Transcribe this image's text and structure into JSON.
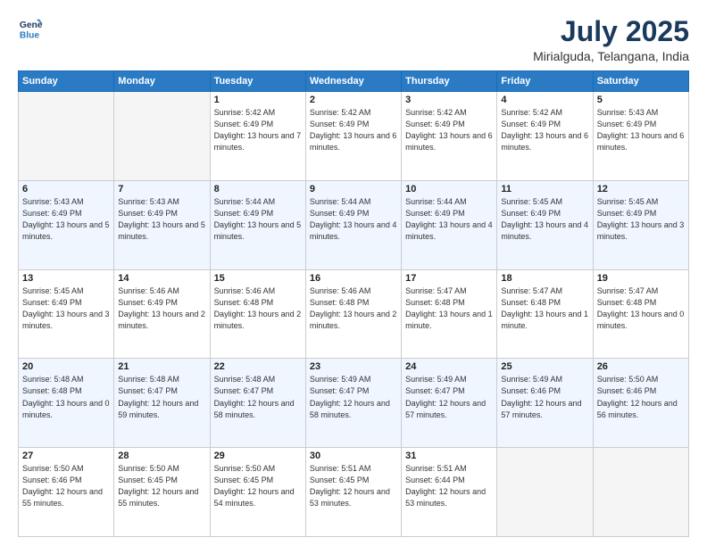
{
  "logo": {
    "line1": "General",
    "line2": "Blue"
  },
  "title": "July 2025",
  "subtitle": "Mirialguda, Telangana, India",
  "weekdays": [
    "Sunday",
    "Monday",
    "Tuesday",
    "Wednesday",
    "Thursday",
    "Friday",
    "Saturday"
  ],
  "weeks": [
    [
      {
        "day": "",
        "detail": ""
      },
      {
        "day": "",
        "detail": ""
      },
      {
        "day": "1",
        "detail": "Sunrise: 5:42 AM\nSunset: 6:49 PM\nDaylight: 13 hours\nand 7 minutes."
      },
      {
        "day": "2",
        "detail": "Sunrise: 5:42 AM\nSunset: 6:49 PM\nDaylight: 13 hours\nand 6 minutes."
      },
      {
        "day": "3",
        "detail": "Sunrise: 5:42 AM\nSunset: 6:49 PM\nDaylight: 13 hours\nand 6 minutes."
      },
      {
        "day": "4",
        "detail": "Sunrise: 5:42 AM\nSunset: 6:49 PM\nDaylight: 13 hours\nand 6 minutes."
      },
      {
        "day": "5",
        "detail": "Sunrise: 5:43 AM\nSunset: 6:49 PM\nDaylight: 13 hours\nand 6 minutes."
      }
    ],
    [
      {
        "day": "6",
        "detail": "Sunrise: 5:43 AM\nSunset: 6:49 PM\nDaylight: 13 hours\nand 5 minutes."
      },
      {
        "day": "7",
        "detail": "Sunrise: 5:43 AM\nSunset: 6:49 PM\nDaylight: 13 hours\nand 5 minutes."
      },
      {
        "day": "8",
        "detail": "Sunrise: 5:44 AM\nSunset: 6:49 PM\nDaylight: 13 hours\nand 5 minutes."
      },
      {
        "day": "9",
        "detail": "Sunrise: 5:44 AM\nSunset: 6:49 PM\nDaylight: 13 hours\nand 4 minutes."
      },
      {
        "day": "10",
        "detail": "Sunrise: 5:44 AM\nSunset: 6:49 PM\nDaylight: 13 hours\nand 4 minutes."
      },
      {
        "day": "11",
        "detail": "Sunrise: 5:45 AM\nSunset: 6:49 PM\nDaylight: 13 hours\nand 4 minutes."
      },
      {
        "day": "12",
        "detail": "Sunrise: 5:45 AM\nSunset: 6:49 PM\nDaylight: 13 hours\nand 3 minutes."
      }
    ],
    [
      {
        "day": "13",
        "detail": "Sunrise: 5:45 AM\nSunset: 6:49 PM\nDaylight: 13 hours\nand 3 minutes."
      },
      {
        "day": "14",
        "detail": "Sunrise: 5:46 AM\nSunset: 6:49 PM\nDaylight: 13 hours\nand 2 minutes."
      },
      {
        "day": "15",
        "detail": "Sunrise: 5:46 AM\nSunset: 6:48 PM\nDaylight: 13 hours\nand 2 minutes."
      },
      {
        "day": "16",
        "detail": "Sunrise: 5:46 AM\nSunset: 6:48 PM\nDaylight: 13 hours\nand 2 minutes."
      },
      {
        "day": "17",
        "detail": "Sunrise: 5:47 AM\nSunset: 6:48 PM\nDaylight: 13 hours\nand 1 minute."
      },
      {
        "day": "18",
        "detail": "Sunrise: 5:47 AM\nSunset: 6:48 PM\nDaylight: 13 hours\nand 1 minute."
      },
      {
        "day": "19",
        "detail": "Sunrise: 5:47 AM\nSunset: 6:48 PM\nDaylight: 13 hours\nand 0 minutes."
      }
    ],
    [
      {
        "day": "20",
        "detail": "Sunrise: 5:48 AM\nSunset: 6:48 PM\nDaylight: 13 hours\nand 0 minutes."
      },
      {
        "day": "21",
        "detail": "Sunrise: 5:48 AM\nSunset: 6:47 PM\nDaylight: 12 hours\nand 59 minutes."
      },
      {
        "day": "22",
        "detail": "Sunrise: 5:48 AM\nSunset: 6:47 PM\nDaylight: 12 hours\nand 58 minutes."
      },
      {
        "day": "23",
        "detail": "Sunrise: 5:49 AM\nSunset: 6:47 PM\nDaylight: 12 hours\nand 58 minutes."
      },
      {
        "day": "24",
        "detail": "Sunrise: 5:49 AM\nSunset: 6:47 PM\nDaylight: 12 hours\nand 57 minutes."
      },
      {
        "day": "25",
        "detail": "Sunrise: 5:49 AM\nSunset: 6:46 PM\nDaylight: 12 hours\nand 57 minutes."
      },
      {
        "day": "26",
        "detail": "Sunrise: 5:50 AM\nSunset: 6:46 PM\nDaylight: 12 hours\nand 56 minutes."
      }
    ],
    [
      {
        "day": "27",
        "detail": "Sunrise: 5:50 AM\nSunset: 6:46 PM\nDaylight: 12 hours\nand 55 minutes."
      },
      {
        "day": "28",
        "detail": "Sunrise: 5:50 AM\nSunset: 6:45 PM\nDaylight: 12 hours\nand 55 minutes."
      },
      {
        "day": "29",
        "detail": "Sunrise: 5:50 AM\nSunset: 6:45 PM\nDaylight: 12 hours\nand 54 minutes."
      },
      {
        "day": "30",
        "detail": "Sunrise: 5:51 AM\nSunset: 6:45 PM\nDaylight: 12 hours\nand 53 minutes."
      },
      {
        "day": "31",
        "detail": "Sunrise: 5:51 AM\nSunset: 6:44 PM\nDaylight: 12 hours\nand 53 minutes."
      },
      {
        "day": "",
        "detail": ""
      },
      {
        "day": "",
        "detail": ""
      }
    ]
  ]
}
